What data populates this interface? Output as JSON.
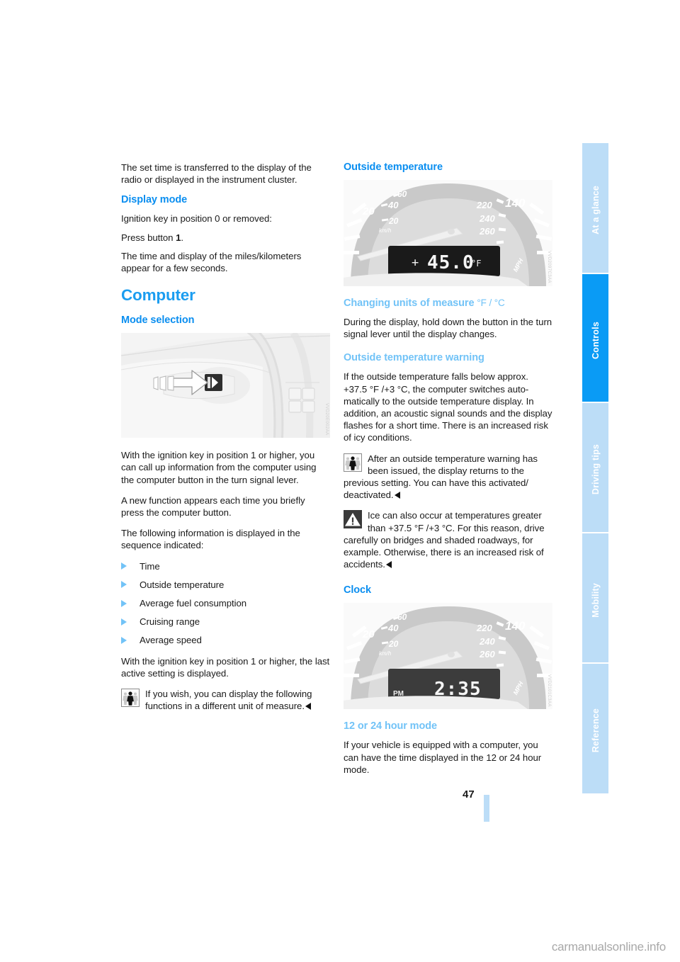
{
  "page": {
    "number": "47",
    "watermark": "carmanualsonline.info"
  },
  "sidenav": {
    "items": [
      {
        "label": "At a glance",
        "active": false
      },
      {
        "label": "Controls",
        "active": true
      },
      {
        "label": "Driving tips",
        "active": false
      },
      {
        "label": "Mobility",
        "active": false
      },
      {
        "label": "Reference",
        "active": false
      }
    ]
  },
  "left_column": {
    "intro_paragraph": "The set time is transferred to the display of the radio or displayed in the instrument cluster.",
    "display_mode": {
      "heading": "Display mode",
      "p1": "Ignition key in position 0 or removed:",
      "p2_prefix": "Press button ",
      "p2_bold": "1",
      "p2_suffix": ".",
      "p3": "The time and display of the miles/kilometers appear for a few seconds."
    },
    "computer": {
      "title": "Computer",
      "mode_selection_heading": "Mode selection",
      "figure_code": "VVD20E002AA",
      "p1": "With the ignition key in position 1 or higher, you can call up information from the computer using the computer button in the turn signal lever.",
      "p2": "A new function appears each time you briefly press the computer button.",
      "p3": "The following information is displayed in the sequence indicated:",
      "bullets": [
        "Time",
        "Outside temperature",
        "Average fuel consumption",
        "Cruising range",
        "Average speed"
      ],
      "p4": "With the ignition key in position 1 or higher, the last active setting is displayed.",
      "note": {
        "icon": "person-note-icon",
        "text": "If you wish, you can display the following functions in a different unit of measure."
      }
    }
  },
  "right_column": {
    "outside_temperature": {
      "heading": "Outside temperature",
      "figure_code": "VVD2097C3AA",
      "cluster": {
        "left_ticks": [
          "20",
          "40",
          "20"
        ],
        "left_unit": "km/h",
        "right_ticks": [
          "220",
          "240",
          "260"
        ],
        "right_big": "140",
        "right_unit": "MPH",
        "lcd_sign": "+",
        "lcd_value": "45.0",
        "lcd_unit": "°F"
      }
    },
    "changing_units": {
      "heading": "Changing units of measure",
      "heading_units": "°F / °C",
      "p1": "During the display, hold down the button in the turn signal lever until the display changes."
    },
    "temperature_warning": {
      "heading": "Outside temperature warning",
      "p1": "If the outside temperature falls below approx. +37.5 °F /+3 °C, the computer switches auto-matically to the outside temperature display. In addition, an acoustic signal sounds and the display flashes for a short time. There is an increased risk of icy conditions.",
      "note": {
        "icon": "person-note-icon",
        "text": "After an outside temperature warning has been issued, the display returns to the previous setting. You can have this activated/ deactivated."
      },
      "warning": {
        "icon": "warning-triangle-icon",
        "text": "Ice can also occur at temperatures greater than +37.5 °F /+3 °C. For this reason, drive carefully on bridges and shaded roadways, for example. Otherwise, there is an increased risk of accidents."
      }
    },
    "clock": {
      "heading": "Clock",
      "figure_code": "VVD2101C3AA",
      "cluster": {
        "left_ticks": [
          "20",
          "40",
          "20"
        ],
        "left_unit": "km/h",
        "right_ticks": [
          "220",
          "240",
          "260"
        ],
        "right_big": "140",
        "right_unit": "MPH",
        "lcd_ampm": "PM",
        "lcd_value": "2:35"
      }
    },
    "hour_mode": {
      "heading": "12 or 24 hour mode",
      "p1": "If your vehicle is equipped with a computer, you can have the time displayed in the 12 or 24 hour mode."
    }
  },
  "colors": {
    "accent_blue": "#0a8ef0",
    "title_blue": "#1b9df0",
    "light_blue": "#72c3f7",
    "nav_inactive": "#bcddf7",
    "nav_active": "#0a9bf5"
  }
}
